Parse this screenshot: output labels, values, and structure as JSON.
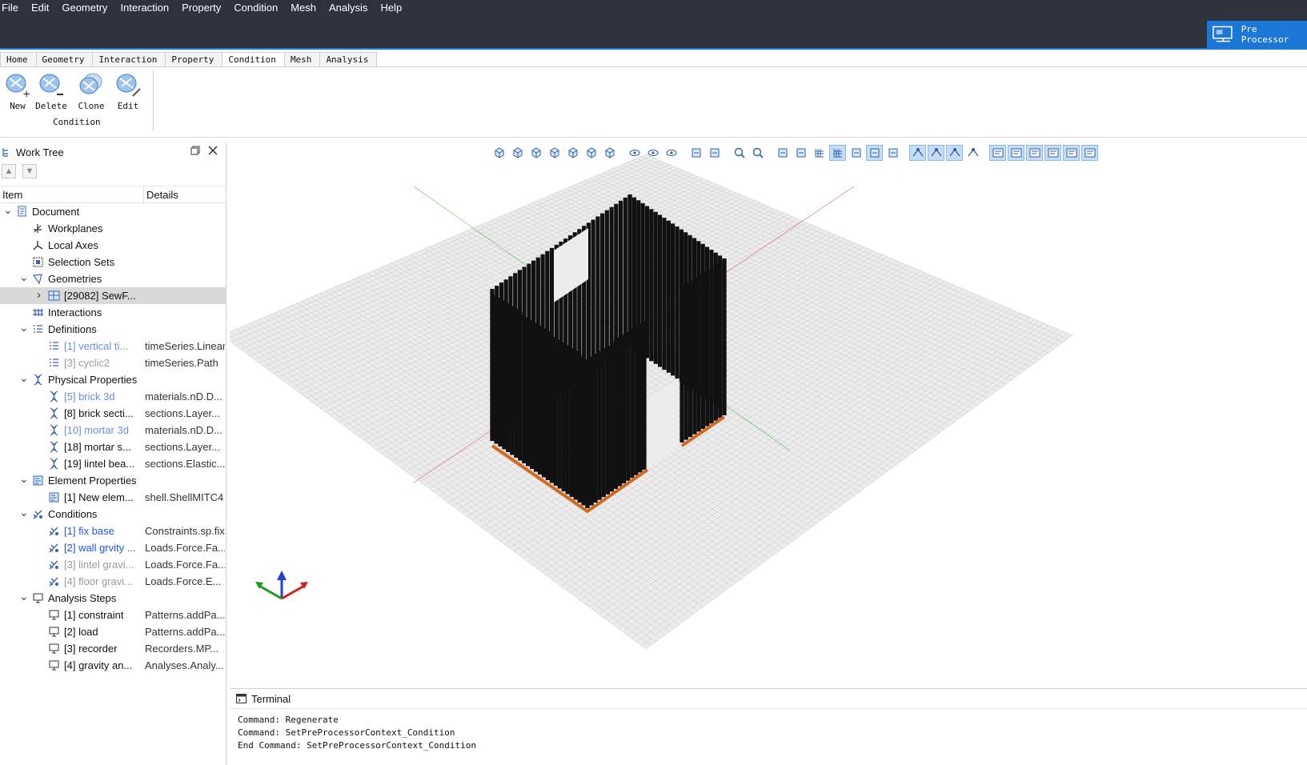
{
  "menu": [
    "File",
    "Edit",
    "Geometry",
    "Interaction",
    "Property",
    "Condition",
    "Mesh",
    "Analysis",
    "Help"
  ],
  "mode": {
    "label": "Pre Processor"
  },
  "ribbon_tabs": [
    {
      "label": "Home",
      "active": false
    },
    {
      "label": "Geometry",
      "active": false
    },
    {
      "label": "Interaction",
      "active": false
    },
    {
      "label": "Property",
      "active": false
    },
    {
      "label": "Condition",
      "active": true
    },
    {
      "label": "Mesh",
      "active": false
    },
    {
      "label": "Analysis",
      "active": false
    }
  ],
  "ribbon": {
    "buttons": [
      "New",
      "Delete",
      "Clone",
      "Edit"
    ],
    "group_label": "Condition"
  },
  "worktree": {
    "title": "Work Tree",
    "col_item": "Item",
    "col_details": "Details",
    "rows": [
      {
        "label": "Document",
        "detail": "",
        "level": 0,
        "caret": "open",
        "icon": "document-icon",
        "style": ""
      },
      {
        "label": "Workplanes",
        "detail": "",
        "level": 1,
        "caret": "",
        "icon": "workplanes-icon",
        "style": ""
      },
      {
        "label": "Local Axes",
        "detail": "",
        "level": 1,
        "caret": "",
        "icon": "axes-icon",
        "style": ""
      },
      {
        "label": "Selection Sets",
        "detail": "",
        "level": 1,
        "caret": "",
        "icon": "selection-sets-icon",
        "style": ""
      },
      {
        "label": "Geometries",
        "detail": "",
        "level": 1,
        "caret": "open",
        "icon": "geometries-icon",
        "style": ""
      },
      {
        "label": "[29082] SewF...",
        "detail": "",
        "level": 2,
        "caret": "closed",
        "icon": "geometry-item-icon",
        "style": "",
        "selected": true
      },
      {
        "label": "Interactions",
        "detail": "",
        "level": 1,
        "caret": "",
        "icon": "interactions-icon",
        "style": ""
      },
      {
        "label": "Definitions",
        "detail": "",
        "level": 1,
        "caret": "open",
        "icon": "definitions-icon",
        "style": ""
      },
      {
        "label": "[1] vertical ti...",
        "detail": "timeSeries.Linear",
        "level": 2,
        "caret": "",
        "icon": "list-icon",
        "style": "lblue"
      },
      {
        "label": "[3] cyclic2",
        "detail": "timeSeries.Path",
        "level": 2,
        "caret": "",
        "icon": "list-icon",
        "style": "gray"
      },
      {
        "label": "Physical Properties",
        "detail": "",
        "level": 1,
        "caret": "open",
        "icon": "dna-icon",
        "style": ""
      },
      {
        "label": "[5] brick 3d",
        "detail": "materials.nD.D...",
        "level": 2,
        "caret": "",
        "icon": "dna-icon",
        "style": "lblue"
      },
      {
        "label": "[8] brick secti...",
        "detail": "sections.Layer...",
        "level": 2,
        "caret": "",
        "icon": "dna-icon",
        "style": ""
      },
      {
        "label": "[10] mortar 3d",
        "detail": "materials.nD.D...",
        "level": 2,
        "caret": "",
        "icon": "dna-icon",
        "style": "lblue"
      },
      {
        "label": "[18] mortar s...",
        "detail": "sections.Layer...",
        "level": 2,
        "caret": "",
        "icon": "dna-icon",
        "style": ""
      },
      {
        "label": "[19] lintel bea...",
        "detail": "sections.Elastic...",
        "level": 2,
        "caret": "",
        "icon": "dna-icon",
        "style": ""
      },
      {
        "label": "Element Properties",
        "detail": "",
        "level": 1,
        "caret": "open",
        "icon": "element-props-icon",
        "style": ""
      },
      {
        "label": "[1] New elem...",
        "detail": "shell.ShellMITC4",
        "level": 2,
        "caret": "",
        "icon": "element-props-icon",
        "style": ""
      },
      {
        "label": "Conditions",
        "detail": "",
        "level": 1,
        "caret": "open",
        "icon": "conditions-icon",
        "style": ""
      },
      {
        "label": "[1] fix base",
        "detail": "Constraints.sp.fix",
        "level": 2,
        "caret": "",
        "icon": "conditions-icon",
        "style": "blue"
      },
      {
        "label": "[2] wall grvity ...",
        "detail": "Loads.Force.Fa...",
        "level": 2,
        "caret": "",
        "icon": "conditions-icon",
        "style": "blue"
      },
      {
        "label": "[3] lintel gravi...",
        "detail": "Loads.Force.Fa...",
        "level": 2,
        "caret": "",
        "icon": "conditions-icon",
        "style": "gray"
      },
      {
        "label": "[4] floor gravi...",
        "detail": "Loads.Force.E...",
        "level": 2,
        "caret": "",
        "icon": "conditions-icon",
        "style": "gray"
      },
      {
        "label": "Analysis Steps",
        "detail": "",
        "level": 1,
        "caret": "open",
        "icon": "analysis-steps-icon",
        "style": ""
      },
      {
        "label": "[1] constraint",
        "detail": "Patterns.addPa...",
        "level": 2,
        "caret": "",
        "icon": "analysis-steps-icon",
        "style": ""
      },
      {
        "label": "[2] load",
        "detail": "Patterns.addPa...",
        "level": 2,
        "caret": "",
        "icon": "analysis-steps-icon",
        "style": ""
      },
      {
        "label": "[3] recorder",
        "detail": "Recorders.MP...",
        "level": 2,
        "caret": "",
        "icon": "analysis-steps-icon",
        "style": ""
      },
      {
        "label": "[4] gravity an...",
        "detail": "Analyses.Analy...",
        "level": 2,
        "caret": "",
        "icon": "analysis-steps-icon",
        "style": ""
      }
    ]
  },
  "terminal": {
    "title": "Terminal",
    "lines": [
      "Command: Regenerate",
      "Command: SetPreProcessorContext_Condition",
      "End Command: SetPreProcessorContext_Condition"
    ]
  },
  "colors": {
    "topbar": "#2d323d",
    "accent": "#1b78d6",
    "model": "#111111",
    "fixity": "#d2691e",
    "axis_x": "#d42020",
    "axis_y": "#1a9a1a",
    "axis_z": "#1f3fd6"
  }
}
